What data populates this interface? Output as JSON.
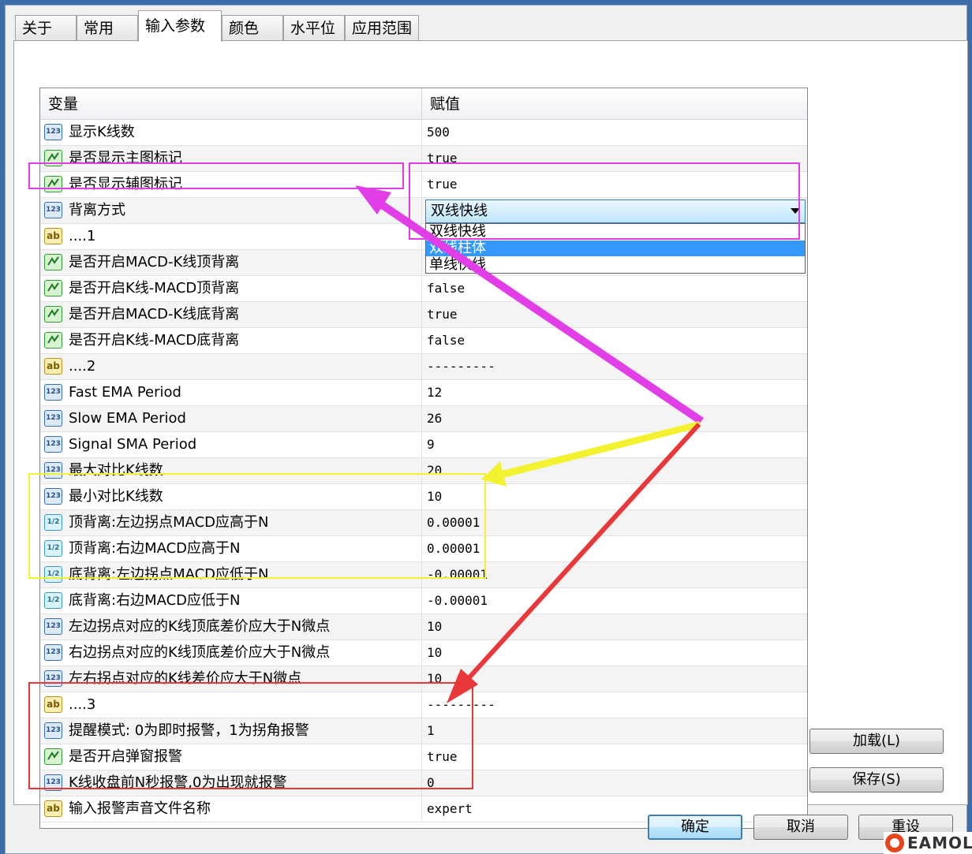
{
  "tabs": [
    {
      "label": "关于"
    },
    {
      "label": "常用"
    },
    {
      "label": "输入参数",
      "active": true
    },
    {
      "label": "颜色"
    },
    {
      "label": "水平位"
    },
    {
      "label": "应用范围"
    }
  ],
  "grid": {
    "header_variable": "变量",
    "header_value": "赋值",
    "rows": [
      {
        "type": "int",
        "name": "显示K线数",
        "value": "500"
      },
      {
        "type": "bool",
        "name": "是否显示主图标记",
        "value": "true"
      },
      {
        "type": "bool",
        "name": "是否显示辅图标记",
        "value": "true"
      },
      {
        "type": "int",
        "name": "背离方式",
        "value": ""
      },
      {
        "type": "string",
        "name": "....1",
        "value": ""
      },
      {
        "type": "bool",
        "name": "是否开启MACD-K线顶背离",
        "value": ""
      },
      {
        "type": "bool",
        "name": "是否开启K线-MACD顶背离",
        "value": "false"
      },
      {
        "type": "bool",
        "name": "是否开启MACD-K线底背离",
        "value": "true"
      },
      {
        "type": "bool",
        "name": "是否开启K线-MACD底背离",
        "value": "false"
      },
      {
        "type": "string",
        "name": "....2",
        "value": "---------"
      },
      {
        "type": "int",
        "name": "Fast EMA Period",
        "value": "12"
      },
      {
        "type": "int",
        "name": "Slow EMA Period",
        "value": "26"
      },
      {
        "type": "int",
        "name": "Signal SMA Period",
        "value": "9"
      },
      {
        "type": "int",
        "name": "最大对比K线数",
        "value": "20"
      },
      {
        "type": "int",
        "name": "最小对比K线数",
        "value": "10"
      },
      {
        "type": "double",
        "name": "顶背离:左边拐点MACD应高于N",
        "value": "0.00001"
      },
      {
        "type": "double",
        "name": "顶背离:右边MACD应高于N",
        "value": "0.00001"
      },
      {
        "type": "double",
        "name": "底背离:左边拐点MACD应低于N",
        "value": "-0.00001"
      },
      {
        "type": "double",
        "name": "底背离:右边MACD应低于N",
        "value": "-0.00001"
      },
      {
        "type": "int",
        "name": "左边拐点对应的K线顶底差价应大于N微点",
        "value": "10"
      },
      {
        "type": "int",
        "name": "右边拐点对应的K线顶底差价应大于N微点",
        "value": "10"
      },
      {
        "type": "int",
        "name": "左右拐点对应的K线差价应大于N微点",
        "value": "10"
      },
      {
        "type": "string",
        "name": "....3",
        "value": "---------"
      },
      {
        "type": "int",
        "name": "提醒模式: 0为即时报警，1为拐角报警",
        "value": "1"
      },
      {
        "type": "bool",
        "name": "是否开启弹窗报警",
        "value": "true"
      },
      {
        "type": "int",
        "name": "K线收盘前N秒报警,0为出现就报警",
        "value": "0"
      },
      {
        "type": "string",
        "name": "输入报警声音文件名称",
        "value": "expert"
      }
    ]
  },
  "dropdown": {
    "selected": "双线快线",
    "options": [
      "双线快线",
      "双线柱体",
      "单线快线"
    ],
    "highlighted_index": 1
  },
  "side_buttons": {
    "load": "加载(L)",
    "save": "保存(S)"
  },
  "bottom_buttons": {
    "ok": "确定",
    "cancel": "取消",
    "reset": "重设"
  },
  "icon_labels": {
    "int": "123",
    "double": "1/2",
    "string": "ab"
  },
  "annotation_colors": {
    "magenta": "#e23ee8",
    "yellow": "#f2f230",
    "red": "#e8383a"
  },
  "watermark": "EAMOL"
}
